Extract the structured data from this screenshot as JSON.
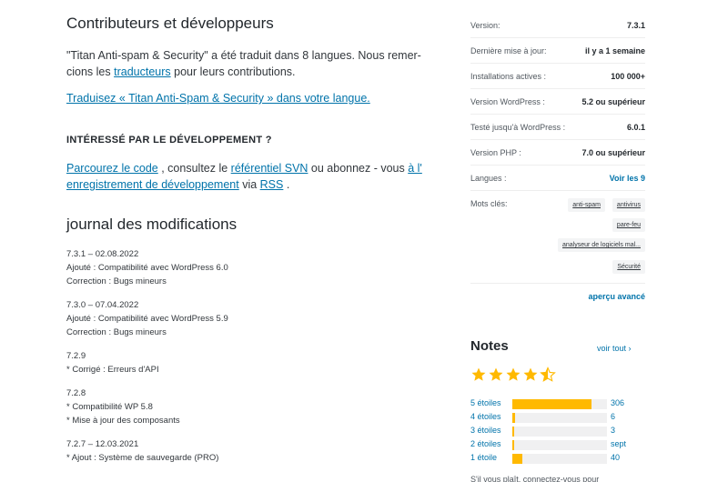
{
  "contributors": {
    "title": "Contributeurs et développeurs",
    "translated_before": "\"Titan Anti-spam & Security\" a été traduit dans 8 langues. Nous remer-cions les ",
    "translators_link": "traducteurs",
    "translated_after": " pour leurs contributions.",
    "translate_link": "Traduisez « Titan Anti-Spam & Security » dans votre langue."
  },
  "development": {
    "title": "INTÉRESSÉ PAR LE DÉVELOPPEMENT ?",
    "browse_link": "Parcourez le code",
    "text_1": " , consultez le ",
    "svn_link": "référentiel SVN",
    "text_2": " ou abonnez - vous ",
    "log_link": "à l' enregistrement de développement",
    "text_3": " via ",
    "rss_link": "RSS",
    "text_4": " ."
  },
  "changelog": {
    "title": "journal des modifications",
    "entries": [
      {
        "version": "7.3.1 – 02.08.2022",
        "lines": [
          "Ajouté : Compatibilité avec WordPress 6.0",
          "Correction : Bugs mineurs"
        ]
      },
      {
        "version": "7.3.0 – 07.04.2022",
        "lines": [
          "Ajouté : Compatibilité avec WordPress 5.9",
          "Correction : Bugs mineurs"
        ]
      },
      {
        "version": "7.2.9",
        "lines": [
          "* Corrigé : Erreurs d'API"
        ]
      },
      {
        "version": "7.2.8",
        "lines": [
          "* Compatibilité WP 5.8",
          "* Mise à jour des composants"
        ]
      },
      {
        "version": "7.2.7 – 12.03.2021",
        "lines": [
          "* Ajout : Système de sauvegarde (PRO)"
        ]
      }
    ]
  },
  "meta": {
    "version_label": "Version:",
    "version_value": "7.3.1",
    "updated_label": "Dernière mise à jour:",
    "updated_value": "il y a 1 semaine",
    "installs_label": "Installations actives :",
    "installs_value": "100 000+",
    "wp_label": "Version WordPress :",
    "wp_value": "5.2 ou supérieur",
    "tested_label": "Testé jusqu'à WordPress :",
    "tested_value": "6.0.1",
    "php_label": "Version PHP :",
    "php_value": "7.0 ou supérieur",
    "languages_label": "Langues :",
    "languages_value": "Voir les 9",
    "tags_label": "Mots clés:",
    "tags": [
      "anti-spam",
      "antivirus",
      "pare-feu",
      "analyseur de logiciels mal...",
      "Sécurité"
    ],
    "advanced_link": "aperçu avancé"
  },
  "ratings": {
    "title": "Notes",
    "see_all": "voir tout",
    "see_all_icon": "chevron-right-icon",
    "stars_value": 4.5,
    "star_color": "#ffb900",
    "rows": [
      {
        "label": "5 étoiles",
        "count": "306",
        "fraction": 0.84
      },
      {
        "label": "4 étoiles",
        "count": "6",
        "fraction": 0.03
      },
      {
        "label": "3 étoiles",
        "count": "3",
        "fraction": 0.015
      },
      {
        "label": "2 étoiles",
        "count": "sept",
        "fraction": 0.02
      },
      {
        "label": "1 étoile",
        "count": "40",
        "fraction": 0.11
      }
    ],
    "cutoff_text": "S'il vous plaît, connectez-vous pour"
  },
  "colors": {
    "link": "#0073aa",
    "accent": "#ffb900",
    "text": "#32373c"
  }
}
